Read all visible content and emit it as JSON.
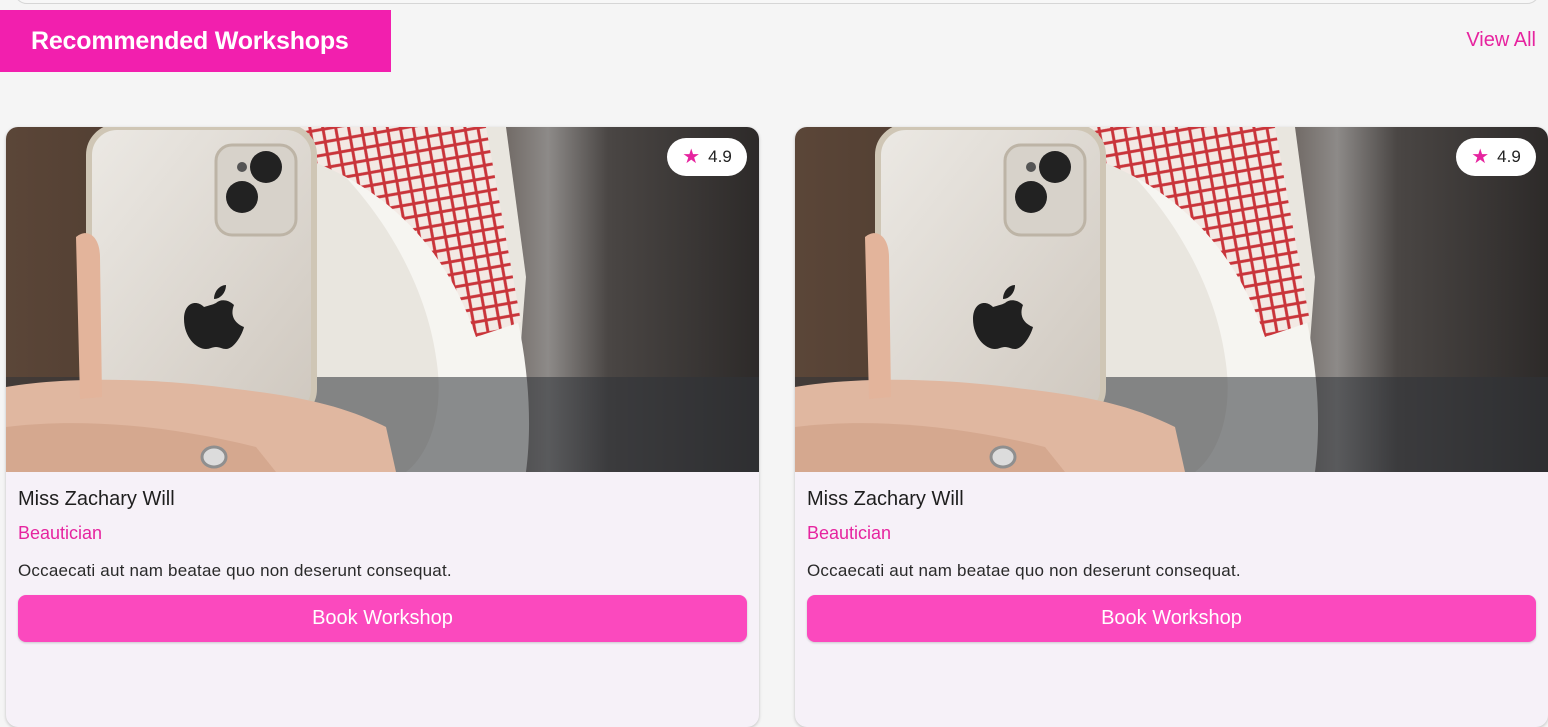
{
  "header": {
    "title": "Recommended Workshops",
    "view_all_label": "View All"
  },
  "colors": {
    "accent": "#f21fae",
    "button": "#fb49be",
    "card_bg": "#f6f1f8",
    "page_bg": "#f5f5f5"
  },
  "workshops": [
    {
      "name": "Miss Zachary Will",
      "role": "Beautician",
      "description": "Occaecati aut nam beatae quo non deserunt consequat.",
      "rating": "4.9",
      "rating_icon": "star-icon",
      "button_label": "Book Workshop"
    },
    {
      "name": "Miss Zachary Will",
      "role": "Beautician",
      "description": "Occaecati aut nam beatae quo non deserunt consequat.",
      "rating": "4.9",
      "rating_icon": "star-icon",
      "button_label": "Book Workshop"
    }
  ]
}
